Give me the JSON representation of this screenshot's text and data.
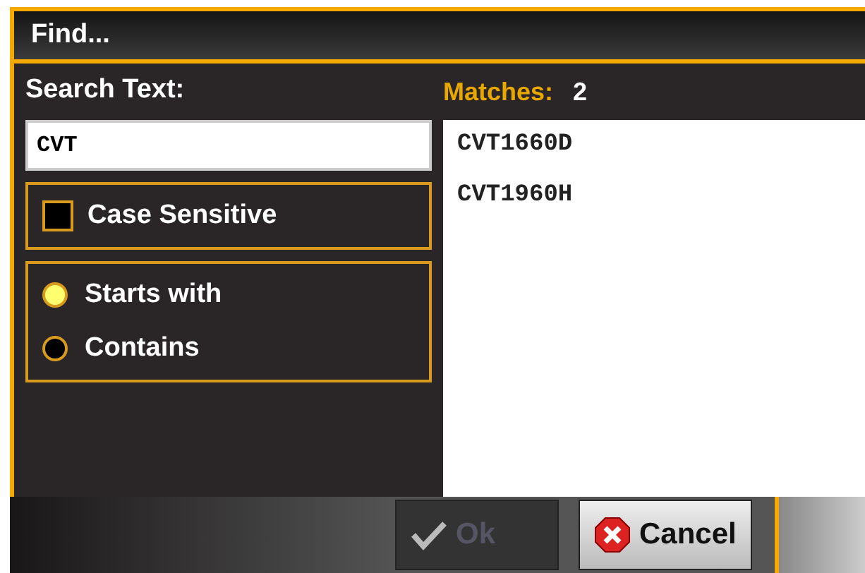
{
  "window": {
    "title": "Find..."
  },
  "search": {
    "label": "Search Text:",
    "value": "CVT"
  },
  "case_sensitive": {
    "label": "Case Sensitive",
    "checked": false
  },
  "match_modes": [
    {
      "label": "Starts with",
      "selected": true
    },
    {
      "label": "Contains",
      "selected": false
    }
  ],
  "matches": {
    "label": "Matches:",
    "count": "2",
    "items": [
      "CVT1660D",
      "CVT1960H"
    ]
  },
  "buttons": [
    {
      "label": "Ok",
      "kind": "ok",
      "disabled": true
    },
    {
      "label": "Cancel",
      "kind": "cancel",
      "disabled": false
    }
  ]
}
